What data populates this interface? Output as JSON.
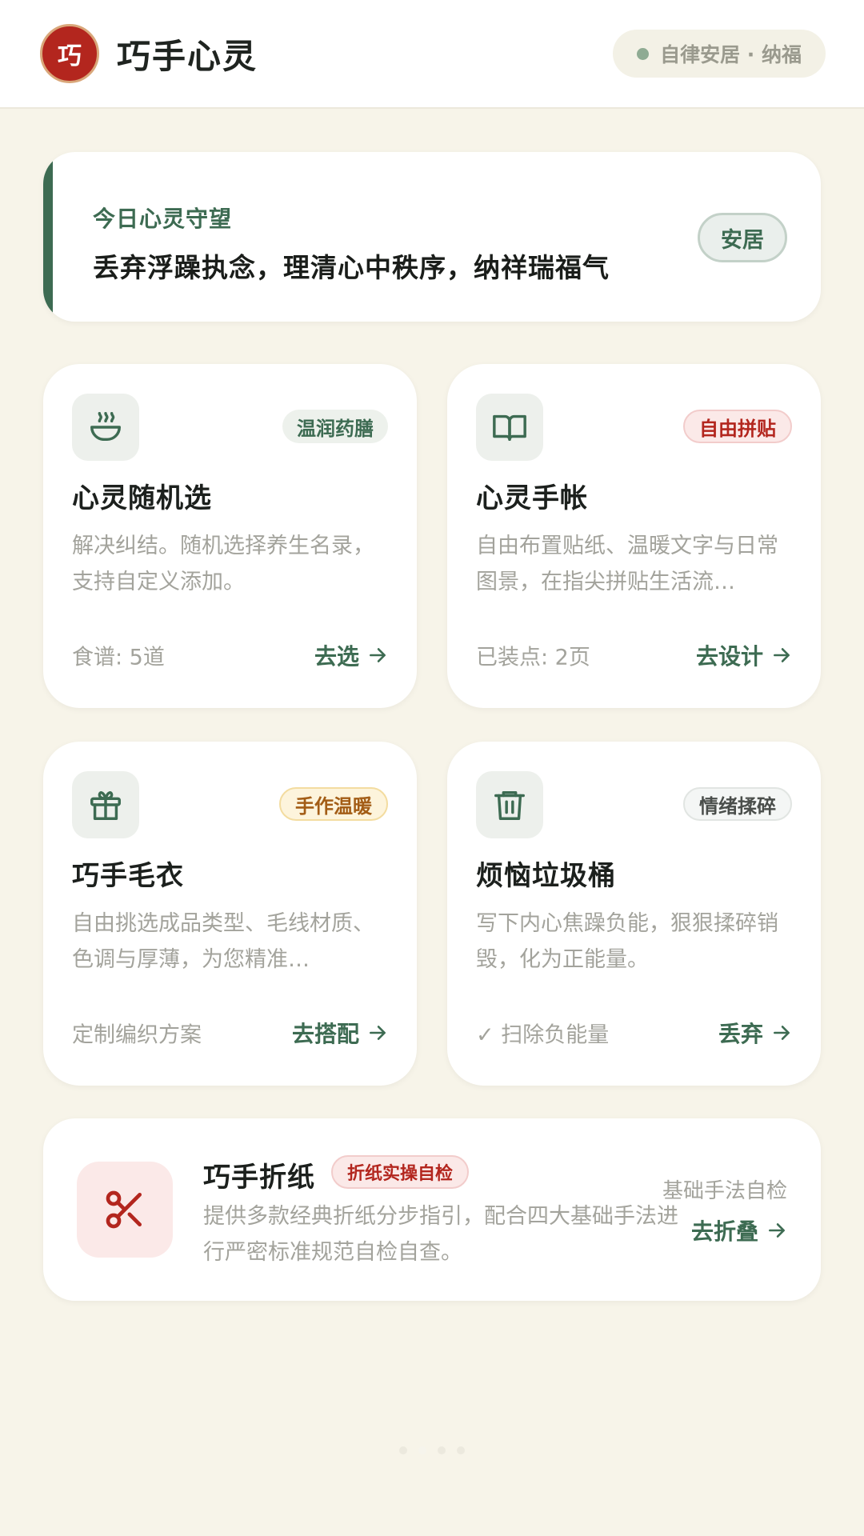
{
  "header": {
    "logo_char": "巧",
    "title": "巧手心灵",
    "status": "自律安居 · 纳福"
  },
  "hero": {
    "subtitle": "今日心灵守望",
    "text": "丢弃浮躁执念，理清心中秩序，纳祥瑞福气",
    "badge": "安居"
  },
  "cards": [
    {
      "icon": "bowl-icon",
      "tag": "温润药膳",
      "title": "心灵随机选",
      "desc": "解决纠结。随机选择养生名录，支持自定义添加。",
      "meta": "食谱: 5道",
      "action": "去选"
    },
    {
      "icon": "book-icon",
      "tag": "自由拼贴",
      "title": "心灵手帐",
      "desc": "自由布置贴纸、温暖文字与日常图景，在指尖拼贴生活流…",
      "meta": "已装点: 2页",
      "action": "去设计"
    },
    {
      "icon": "gift-icon",
      "tag": "手作温暖",
      "title": "巧手毛衣",
      "desc": "自由挑选成品类型、毛线材质、色调与厚薄，为您精准…",
      "meta": "定制编织方案",
      "action": "去搭配"
    },
    {
      "icon": "trash-icon",
      "tag": "情绪揉碎",
      "title": "烦恼垃圾桶",
      "desc": "写下内心焦躁负能，狠狠揉碎销毁，化为正能量。",
      "meta": "✓ 扫除负能量",
      "action": "丢弃"
    }
  ],
  "wide_card": {
    "icon": "scissors-icon",
    "title": "巧手折纸",
    "tag": "折纸实操自检",
    "desc": "提供多款经典折纸分步指引，配合四大基础手法进行严密标准规范自检自查。",
    "meta": "基础手法自检",
    "action": "去折叠"
  },
  "pagination": {
    "pages": 4,
    "active": 2
  },
  "colors": {
    "accent": "#3d6b52",
    "brand_red": "#b3261e",
    "background": "#f7f4e9"
  }
}
